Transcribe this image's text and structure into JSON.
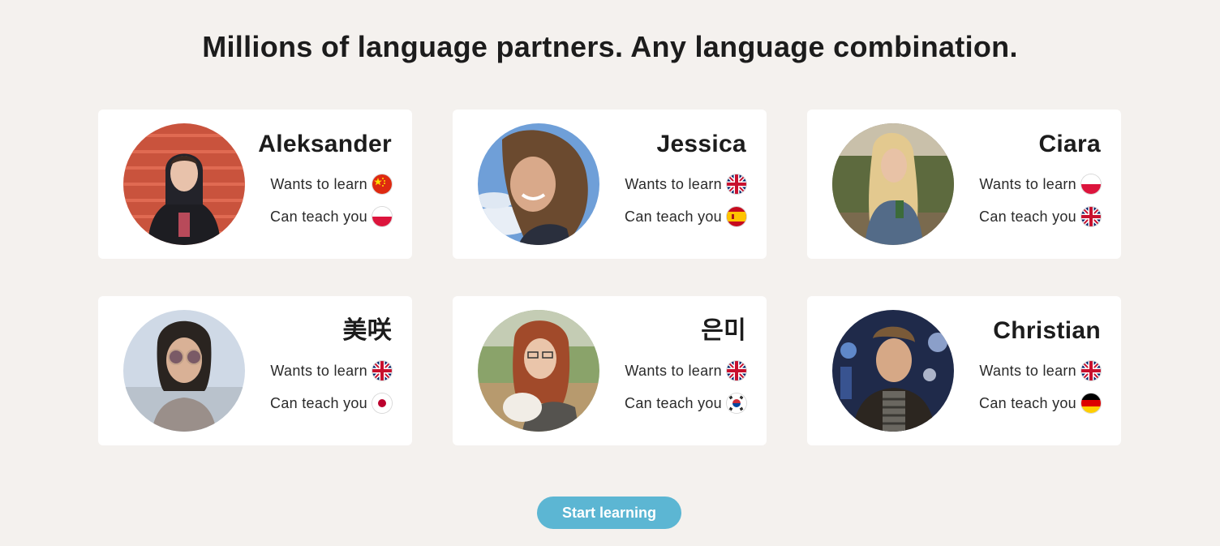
{
  "headline": "Millions of language partners. Any language combination.",
  "labels": {
    "wants": "Wants to learn",
    "teach": "Can teach you"
  },
  "partners": [
    {
      "name": "Aleksander",
      "wants_flag": "china-flag-icon",
      "teach_flag": "poland-flag-icon"
    },
    {
      "name": "Jessica",
      "wants_flag": "uk-flag-icon",
      "teach_flag": "spain-flag-icon"
    },
    {
      "name": "Ciara",
      "wants_flag": "poland-flag-icon",
      "teach_flag": "uk-flag-icon"
    },
    {
      "name": "美咲",
      "wants_flag": "uk-flag-icon",
      "teach_flag": "japan-flag-icon"
    },
    {
      "name": "은미",
      "wants_flag": "uk-flag-icon",
      "teach_flag": "south-korea-flag-icon"
    },
    {
      "name": "Christian",
      "wants_flag": "uk-flag-icon",
      "teach_flag": "germany-flag-icon"
    }
  ],
  "cta": {
    "label": "Start learning"
  },
  "colors": {
    "background": "#f4f1ee",
    "card": "#ffffff",
    "accent": "#5cb6d3"
  }
}
